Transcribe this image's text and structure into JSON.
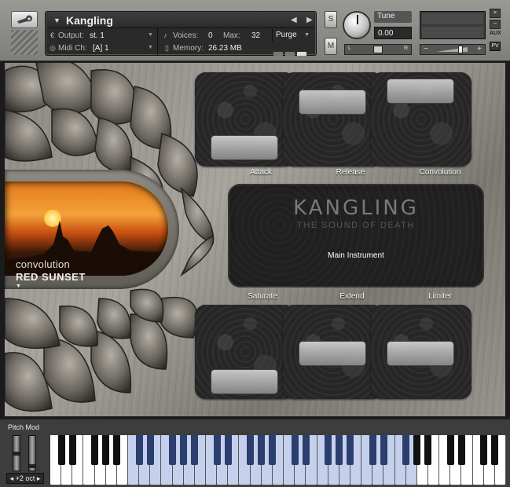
{
  "header": {
    "instrument_name": "Kangling",
    "output_label": "Output:",
    "output_value": "st. 1",
    "midi_label": "Midi Ch:",
    "midi_value": "[A] 1",
    "voices_label": "Voices:",
    "voices_value": "0",
    "max_label": "Max:",
    "max_value": "32",
    "memory_label": "Memory:",
    "memory_value": "26.23 MB",
    "purge_label": "Purge",
    "solo_label": "S",
    "mute_label": "M",
    "tune_label": "Tune",
    "tune_value": "0.00",
    "pan_left": "L",
    "pan_right": "R",
    "vol_minus": "−",
    "vol_plus": "+",
    "close_label": "×",
    "minimize_label": "−",
    "aux_label": "AUX",
    "pv_label": "PV",
    "nav_prev": "◀",
    "nav_next": "▶"
  },
  "preset": {
    "type": "convolution",
    "name": "RED SUNSET",
    "arrow": "▼"
  },
  "controls": {
    "attack": "Attack",
    "release": "Release",
    "convolution": "Convolution",
    "saturate": "Saturate",
    "extend": "Extend",
    "limiter": "Limiter"
  },
  "display": {
    "brand_name": "KANGLING",
    "tagline": "THE SOUND OF DEATH",
    "main_label": "Main Instrument"
  },
  "keyboard": {
    "pitch_mod_label": "Pitch Mod",
    "octave_label": "+2 oct",
    "octave_prev": "◂",
    "octave_next": "▸"
  },
  "colors": {
    "key_highlight": "#c5d1ec",
    "black_key_highlight": "#2b3e6e"
  }
}
